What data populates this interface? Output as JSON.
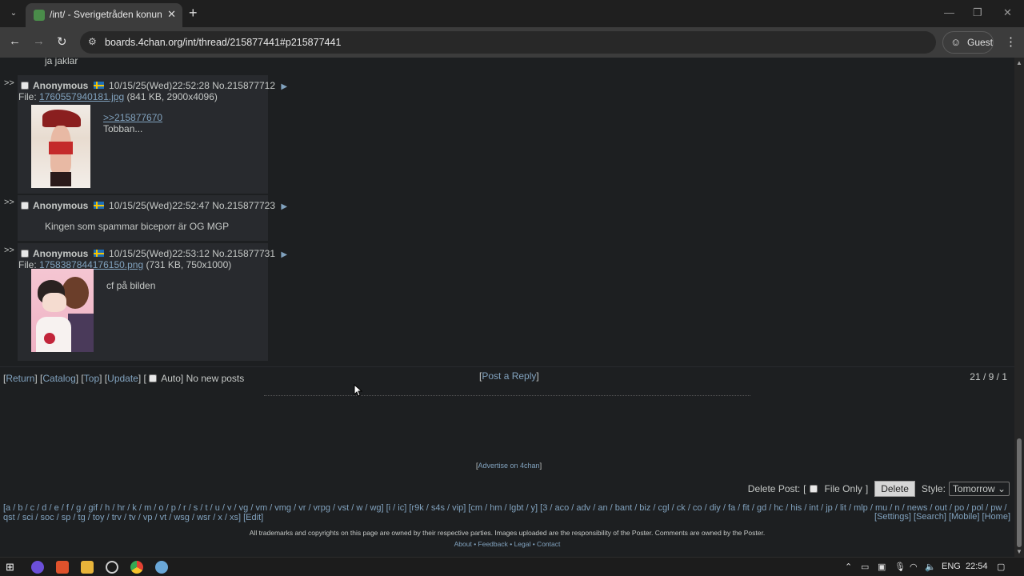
{
  "browser": {
    "tab_title": "/int/ - Sverigetråden konungen",
    "url": "boards.4chan.org/int/thread/215877441#p215877441",
    "profile": "Guest"
  },
  "thread": {
    "cut_text": "ja jaklar",
    "posts": [
      {
        "arrows": ">>",
        "name": "Anonymous",
        "date": "10/15/25(Wed)22:52:28",
        "no": "No.215877712",
        "file_label": "File:",
        "file_name": "1760557940181.jpg",
        "file_meta": "(841 KB, 2900x4096)",
        "quote": ">>215877670",
        "text": "Tobban..."
      },
      {
        "arrows": ">>",
        "name": "Anonymous",
        "date": "10/15/25(Wed)22:52:47",
        "no": "No.215877723",
        "text": "Kingen som spammar biceporr är OG MGP"
      },
      {
        "arrows": ">>",
        "name": "Anonymous",
        "date": "10/15/25(Wed)22:53:12",
        "no": "No.215877731",
        "file_label": "File:",
        "file_name": "1758387844176150.png",
        "file_meta": "(731 KB, 750x1000)",
        "text": "cf på bilden"
      }
    ]
  },
  "bottom_nav": {
    "return": "Return",
    "catalog": "Catalog",
    "top": "Top",
    "update": "Update",
    "auto": "Auto",
    "status": "No new posts",
    "post_reply": "Post a Reply",
    "stats": "21 / 9 / 1"
  },
  "advertise": "Advertise on 4chan",
  "delete": {
    "label": "Delete Post:",
    "file_only": "File Only",
    "button": "Delete",
    "style_label": "Style:",
    "style_value": "Tomorrow"
  },
  "boardlist_line1": "[a / b / c / d / e / f / g / gif / h / hr / k / m / o / p / r / s / t / u / v / vg / vm / vmg / vr / vrpg / vst / w / wg] [i / ic] [r9k / s4s / vip] [cm / hm / lgbt / y] [3 / aco / adv / an / bant / biz / cgl / ck / co / diy / fa / fit / gd / hc / his / int / jp / lit / mlp / mu / n / news / out / po / pol / pw /",
  "boardlist_line2": "qst / sci / soc / sp / tg / toy / trv / tv / vp / vt / wsg / wsr / x / xs] [Edit]",
  "boardlist_right": "[Settings] [Search] [Mobile] [Home]",
  "footer_note": "All trademarks and copyrights on this page are owned by their respective parties. Images uploaded are the responsibility of the Poster. Comments are owned by the Poster.",
  "footer_links": "About • Feedback • Legal • Contact",
  "taskbar": {
    "lang": "ENG",
    "time": "22:54"
  }
}
